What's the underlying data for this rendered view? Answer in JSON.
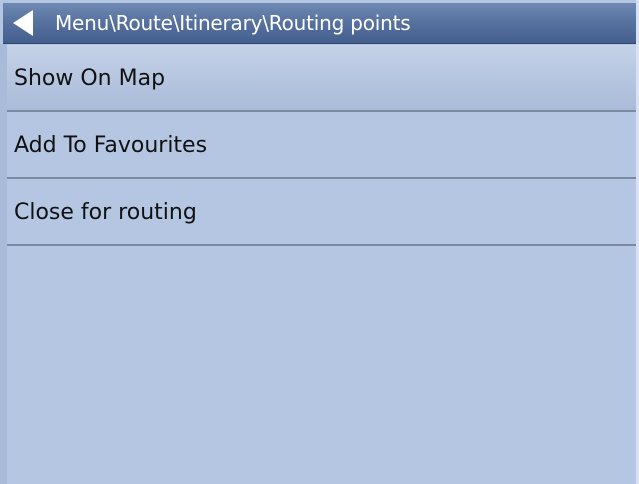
{
  "header": {
    "breadcrumb": "Menu\\Route\\Itinerary\\Routing points"
  },
  "menu": {
    "items": [
      {
        "label": "Show On Map"
      },
      {
        "label": "Add To Favourites"
      },
      {
        "label": "Close for routing"
      }
    ]
  },
  "colors": {
    "background": "#b4c6e2",
    "header": "#5873a0",
    "text": "#111111",
    "divider": "#7a8aa1"
  },
  "icons": {
    "back": "back-arrow-icon"
  }
}
